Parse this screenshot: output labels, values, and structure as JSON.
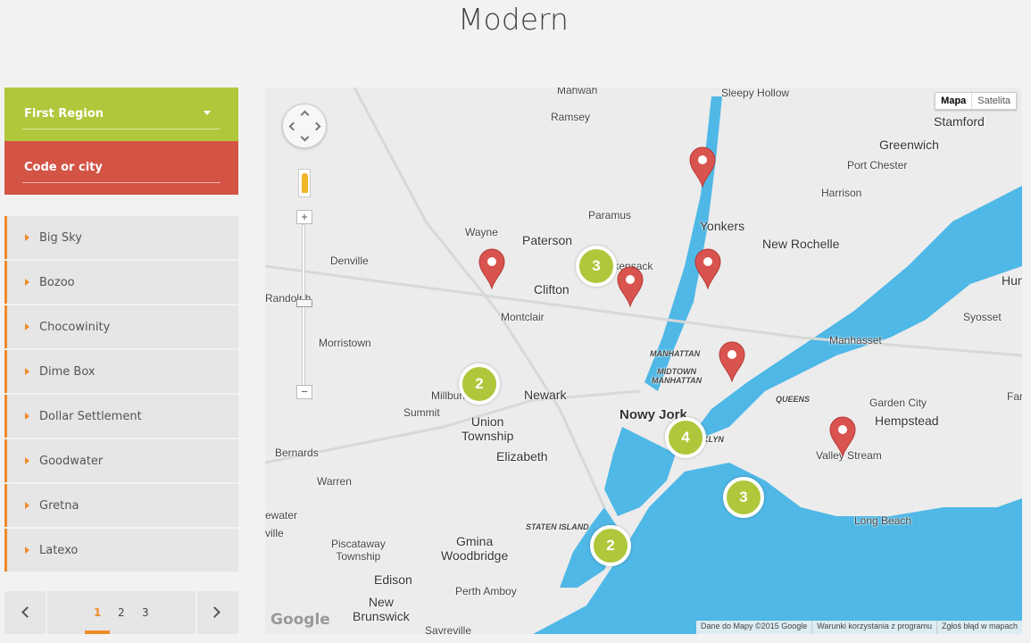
{
  "page": {
    "title": "Modern"
  },
  "filters": {
    "region": {
      "label": "First Region"
    },
    "city": {
      "label": "Code or city"
    }
  },
  "locations": [
    {
      "name": "Big Sky"
    },
    {
      "name": "Bozoo"
    },
    {
      "name": "Chocowinity"
    },
    {
      "name": "Dime Box"
    },
    {
      "name": "Dollar Settlement"
    },
    {
      "name": "Goodwater"
    },
    {
      "name": "Gretna"
    },
    {
      "name": "Latexo"
    }
  ],
  "pagination": {
    "pages": [
      "1",
      "2",
      "3"
    ],
    "current": "1"
  },
  "map": {
    "type_buttons": {
      "map": "Mapa",
      "satellite": "Satelita"
    },
    "zoom_in": "+",
    "zoom_out": "−",
    "logo": "Google",
    "attribution": [
      "Dane do Mapy ©2015 Google",
      "Warunki korzystania z programu",
      "Zgłoś błąd w mapach"
    ],
    "clusters": [
      {
        "count": "3"
      },
      {
        "count": "2"
      },
      {
        "count": "4"
      },
      {
        "count": "3"
      },
      {
        "count": "2"
      }
    ],
    "labels": {
      "mahwah": "Mahwah",
      "sleepy_hollow": "Sleepy Hollow",
      "ramsey": "Ramsey",
      "stamford": "Stamford",
      "greenwich": "Greenwich",
      "port_chester": "Port Chester",
      "harrison": "Harrison",
      "paramus": "Paramus",
      "yonkers": "Yonkers",
      "new_rochelle": "New Rochelle",
      "wayne": "Wayne",
      "paterson": "Paterson",
      "hackensack": "Hackensack",
      "denville": "Denville",
      "clifton": "Clifton",
      "randolph": "Randolph",
      "montclair": "Montclair",
      "syosset": "Syosset",
      "morristown": "Morristown",
      "manhattan": "MANHATTAN",
      "manhasset": "Manhasset",
      "midtown": "MIDTOWN\nMANHATTAN",
      "newark": "Newark",
      "millburn": "Millburn",
      "queens": "QUEENS",
      "garden_city": "Garden City",
      "summit": "Summit",
      "nowy_jork": "Nowy Jork",
      "hempstead": "Hempstead",
      "union": "Union\nTownship",
      "brooklyn": "BROOKLYN",
      "bernards": "Bernards",
      "elizabeth": "Elizabeth",
      "valley_stream": "Valley Stream",
      "warren": "Warren",
      "staten_island": "STATEN ISLAND",
      "long_beach": "Long Beach",
      "gmina": "Gmina\nWoodbridge",
      "piscataway": "Piscataway\nTownship",
      "edison": "Edison",
      "perth_amboy": "Perth Amboy",
      "new_brunswick": "New\nBrunswick",
      "sayreville": "Sayreville",
      "hunt": "Hun",
      "farmin": "Farmin",
      "bridgewater": "ewater",
      "ville": "ville"
    }
  }
}
